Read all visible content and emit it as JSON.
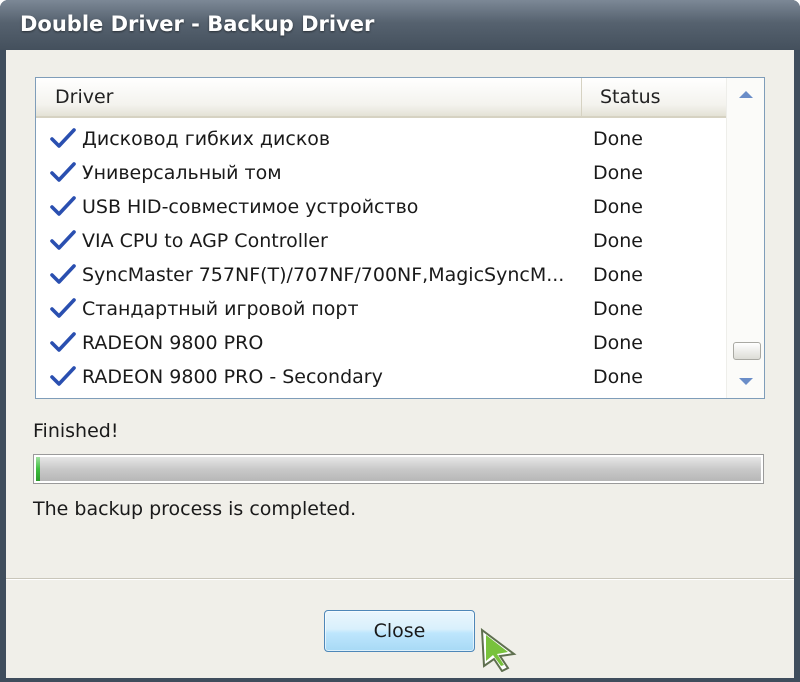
{
  "window": {
    "title": "Double Driver - Backup Driver"
  },
  "listview": {
    "columns": {
      "driver": "Driver",
      "status": "Status"
    },
    "rows": [
      {
        "name": "Дисковод гибких дисков",
        "status": "Done",
        "icon": "checkmark-icon"
      },
      {
        "name": "Универсальный том",
        "status": "Done",
        "icon": "checkmark-icon"
      },
      {
        "name": "USB HID-совместимое устройство",
        "status": "Done",
        "icon": "checkmark-icon"
      },
      {
        "name": "VIA CPU to AGP Controller",
        "status": "Done",
        "icon": "checkmark-icon"
      },
      {
        "name": "SyncMaster 757NF(T)/707NF/700NF,MagicSyncM...",
        "status": "Done",
        "icon": "checkmark-icon"
      },
      {
        "name": "Стандартный игровой порт",
        "status": "Done",
        "icon": "checkmark-icon"
      },
      {
        "name": "RADEON 9800 PRO",
        "status": "Done",
        "icon": "checkmark-icon"
      },
      {
        "name": "RADEON 9800 PRO - Secondary",
        "status": "Done",
        "icon": "checkmark-icon"
      }
    ]
  },
  "progress": {
    "label": "Finished!",
    "value_fraction": 0.005,
    "fill_color": "#3fbf3f"
  },
  "message": "The backup process is completed.",
  "buttons": {
    "close": "Close"
  },
  "colors": {
    "title_bar": "#56626f",
    "check": "#2a4fb0"
  }
}
